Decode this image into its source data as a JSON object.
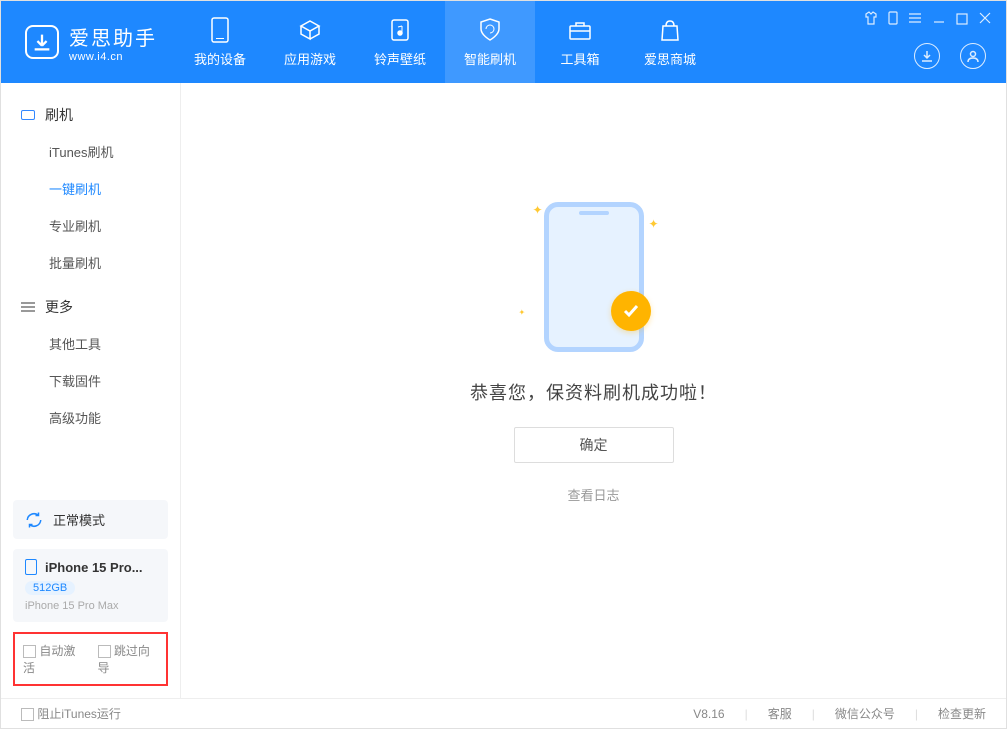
{
  "brand": {
    "title": "爱思助手",
    "subtitle": "www.i4.cn"
  },
  "nav": [
    {
      "label": "我的设备"
    },
    {
      "label": "应用游戏"
    },
    {
      "label": "铃声壁纸"
    },
    {
      "label": "智能刷机"
    },
    {
      "label": "工具箱"
    },
    {
      "label": "爱思商城"
    }
  ],
  "sidebar": {
    "group1_title": "刷机",
    "group1_items": [
      "iTunes刷机",
      "一键刷机",
      "专业刷机",
      "批量刷机"
    ],
    "group2_title": "更多",
    "group2_items": [
      "其他工具",
      "下载固件",
      "高级功能"
    ],
    "mode_label": "正常模式",
    "device_name": "iPhone 15 Pro...",
    "storage": "512GB",
    "device_model": "iPhone 15 Pro Max",
    "cb1": "自动激活",
    "cb2": "跳过向导"
  },
  "main": {
    "success_text": "恭喜您，保资料刷机成功啦！",
    "ok_button": "确定",
    "log_link": "查看日志"
  },
  "status": {
    "block_itunes": "阻止iTunes运行",
    "version": "V8.16",
    "support": "客服",
    "wechat": "微信公众号",
    "update": "检查更新"
  }
}
